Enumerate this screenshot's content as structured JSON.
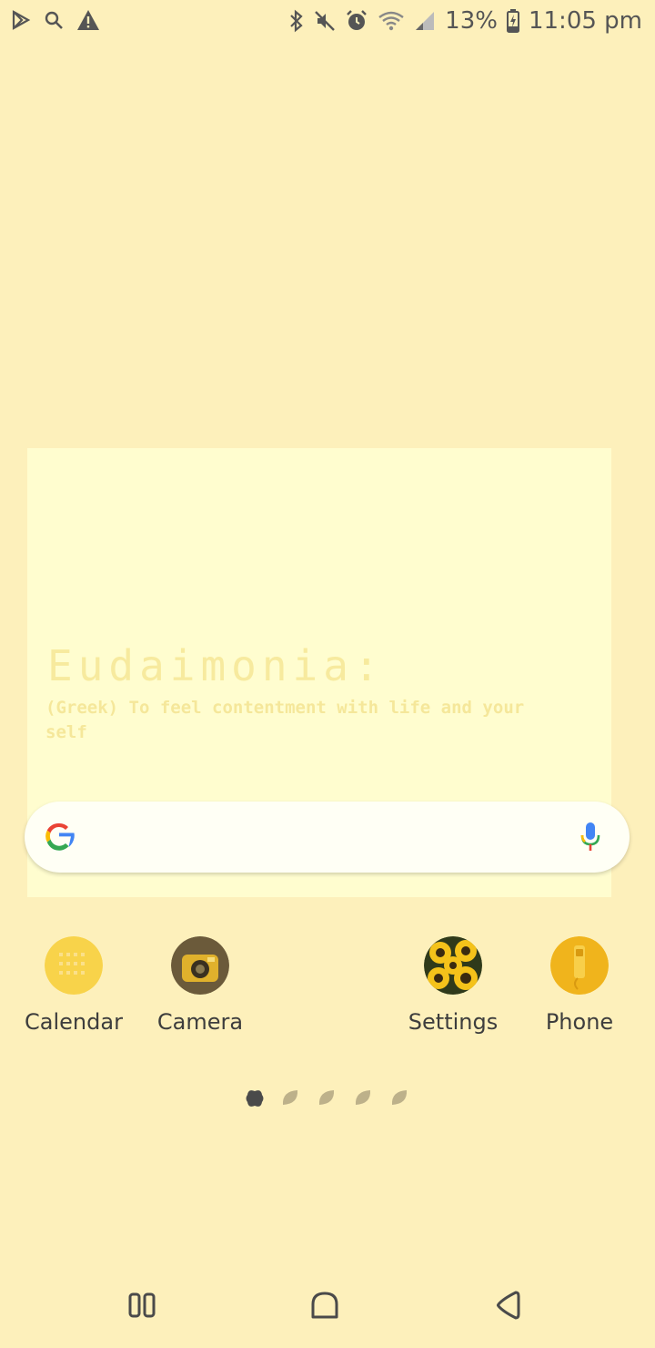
{
  "status_bar": {
    "battery": "13%",
    "time": "11:05 pm",
    "left_icons": [
      "play-store-icon",
      "search-icon",
      "warning-icon"
    ],
    "right_icons": [
      "bluetooth-icon",
      "mute-icon",
      "alarm-icon",
      "wifi-icon",
      "signal-icon",
      "battery-charging-icon"
    ]
  },
  "widget": {
    "title": "Eudaimonia:",
    "body": "(Greek) To feel contentment with life and your self"
  },
  "search": {
    "logo": "google-icon",
    "mic": "mic-icon"
  },
  "apps": [
    {
      "label": "Calendar",
      "icon": "calendar-icon"
    },
    {
      "label": "Camera",
      "icon": "camera-icon"
    },
    {
      "label": "Settings",
      "icon": "settings-icon"
    },
    {
      "label": "Phone",
      "icon": "phone-icon"
    }
  ],
  "pages": {
    "count": 5,
    "active": 1
  },
  "nav": [
    "recents-button",
    "home-button",
    "back-button"
  ],
  "colors": {
    "background": "#fdf0bb",
    "widget": "#fffdcf",
    "accent": "#f6d54a"
  }
}
